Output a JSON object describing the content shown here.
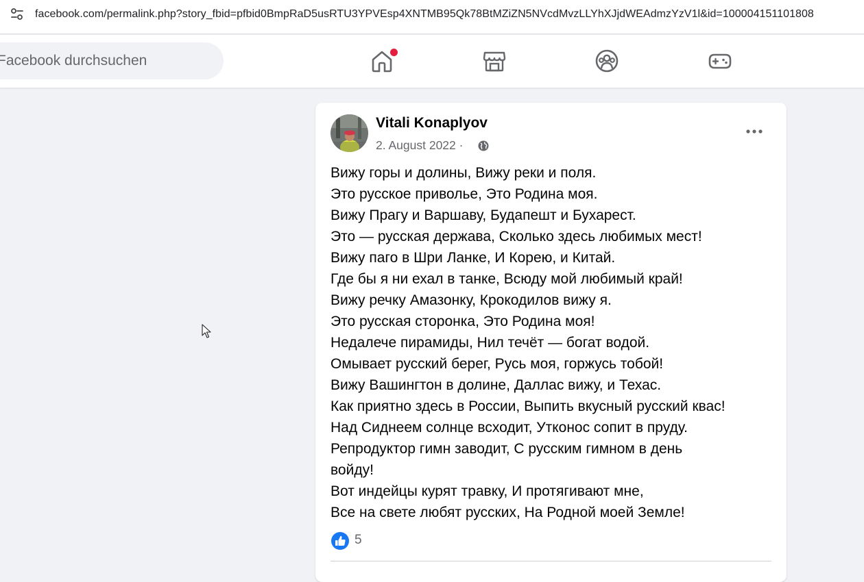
{
  "browser": {
    "url": "facebook.com/permalink.php?story_fbid=pfbid0BmpRaD5usRTU3YPVEsp4XNTMB95Qk78BtMZiZN5NVcdMvzLLYhXJjdWEAdmzYzV1l&id=100004151101808",
    "site_info_icon": "tune-icon"
  },
  "header": {
    "search_placeholder": "Facebook durchsuchen",
    "nav": [
      {
        "name": "home",
        "icon": "home-icon",
        "has_notification": true
      },
      {
        "name": "marketplace",
        "icon": "store-icon"
      },
      {
        "name": "groups",
        "icon": "groups-icon"
      },
      {
        "name": "gaming",
        "icon": "gamepad-icon"
      }
    ]
  },
  "post": {
    "author": "Vitali Konaplyov",
    "date": "2. August 2022",
    "separator": " · ",
    "audience_icon": "globe-icon",
    "lines": [
      "Вижу горы и долины, Вижу реки и поля.",
      "Это русское приволье, Это Родина моя.",
      "Вижу Прагу и Варшаву, Будапешт и Бухарест.",
      "Это — русская держава, Сколько здесь любимых мест!",
      "Вижу паго в Шри Ланке, И Корею, и Китай.",
      "Где бы я ни ехал в танке, Всюду мой любимый край!",
      "Вижу речку Амазонку, Крокодилов вижу я.",
      "Это русская сторонка, Это Родина моя!",
      "Недалече пирамиды, Нил течёт — богат водой.",
      "Омывает русский берег, Русь моя, горжусь тобой!",
      "Вижу Вашингтон в долине, Даллас вижу, и Техас.",
      "Как приятно здесь в России, Выпить вкусный русский квас!",
      "Над Сиднеем солнце всходит, Утконос сопит в пруду.",
      "Репродуктор гимн заводит, С русским гимном в день войду!",
      "Вот индейцы курят травку, И протягивают мне,",
      "Все на свете любят русских, На Родной моей Земле!"
    ],
    "reactions": {
      "icon": "like-icon",
      "count": "5"
    }
  },
  "colors": {
    "accent": "#1877f2",
    "notification": "#e41e3f",
    "background": "#f0f2f5",
    "secondary_text": "#65676b"
  }
}
